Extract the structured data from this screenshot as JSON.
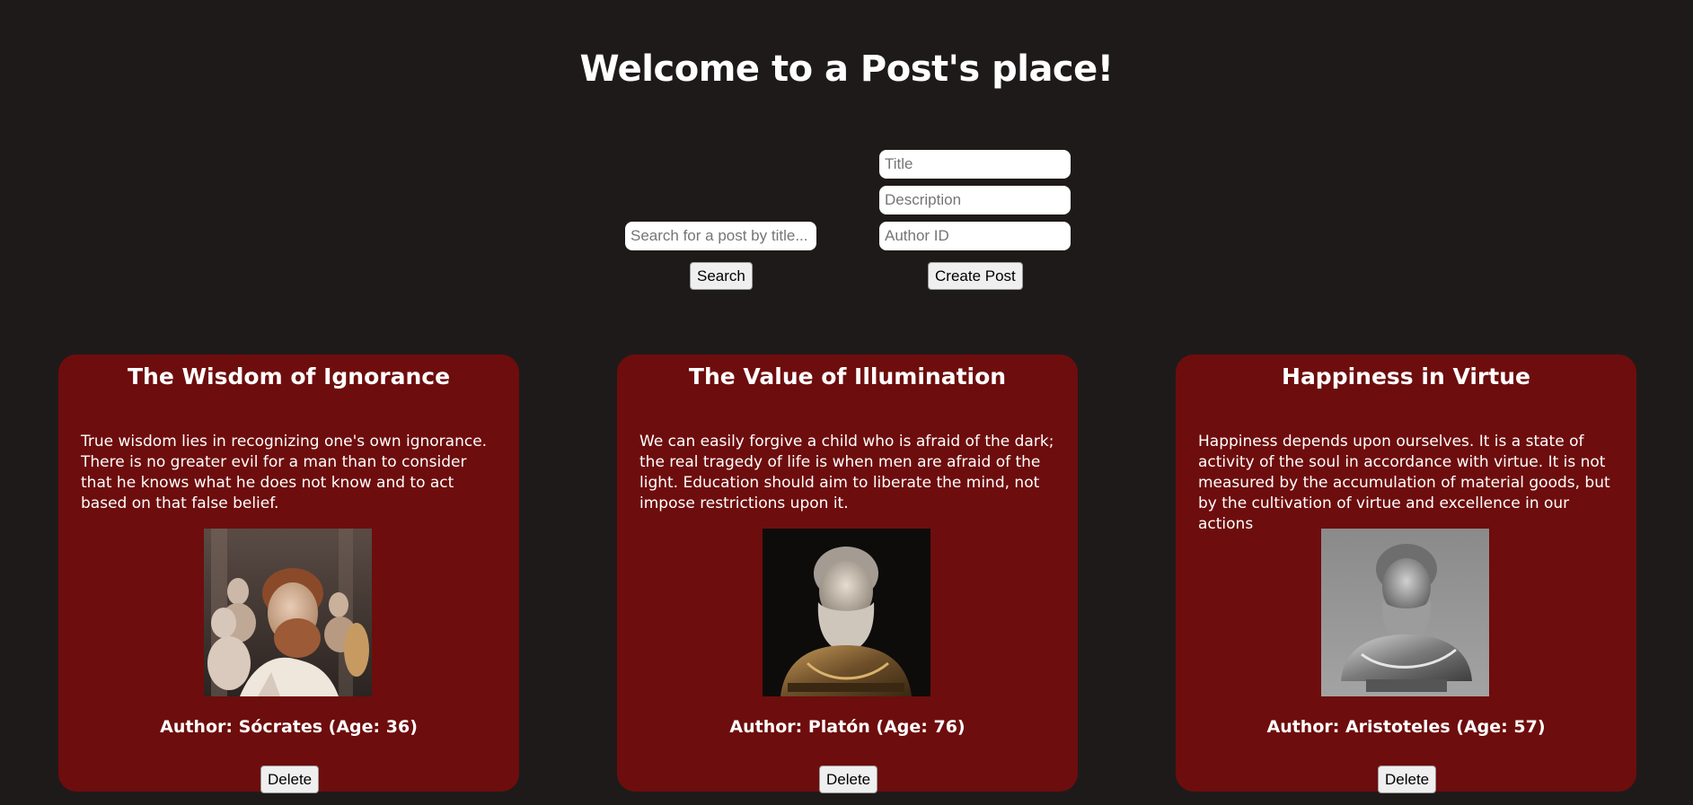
{
  "header": {
    "title": "Welcome to a Post's place!"
  },
  "search": {
    "placeholder": "Search for a post by title...",
    "button_label": "Search"
  },
  "create": {
    "title_placeholder": "Title",
    "description_placeholder": "Description",
    "author_id_placeholder": "Author ID",
    "button_label": "Create Post"
  },
  "posts": [
    {
      "title": "The Wisdom of Ignorance",
      "description": "True wisdom lies in recognizing one's own ignorance. There is no greater evil for a man than to consider that he knows what he does not know and to act based on that false belief.",
      "image": "marble-bust-gallery",
      "author": "Author: Sócrates (Age: 36)",
      "delete_label": "Delete"
    },
    {
      "title": "The Value of Illumination",
      "description": "We can easily forgive a child who is afraid of the dark; the real tragedy of life is when men are afraid of the light. Education should aim to liberate the mind, not impose restrictions upon it.",
      "image": "bronze-bust-dark",
      "author": "Author: Platón (Age: 76)",
      "delete_label": "Delete"
    },
    {
      "title": "Happiness in Virtue",
      "description": "Happiness depends upon ourselves. It is a state of activity of the soul in accordance with virtue. It is not measured by the accumulation of material goods, but by the cultivation of virtue and excellence in our actions",
      "image": "silver-bust-grey",
      "author": "Author: Aristoteles (Age: 57)",
      "delete_label": "Delete"
    }
  ],
  "colors": {
    "background": "#1f1a1a",
    "card": "#6e0d0d",
    "text": "#ffffff"
  }
}
